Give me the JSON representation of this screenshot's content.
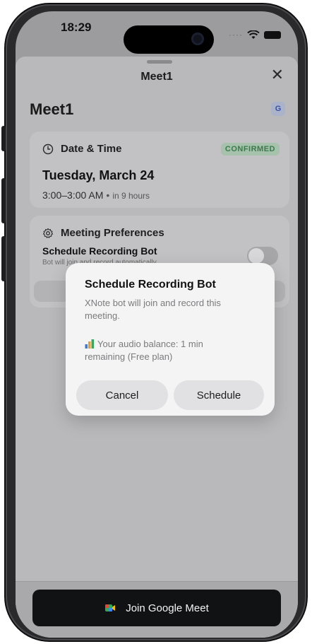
{
  "status_bar": {
    "time": "18:29",
    "signal_icon": "signal-dots-icon",
    "wifi_icon": "wifi-icon",
    "battery_icon": "battery-icon"
  },
  "sheet": {
    "title": "Meet1",
    "close_label": "✕"
  },
  "page": {
    "title": "Meet1",
    "provider_badge": "G"
  },
  "date_time_card": {
    "heading": "Date & Time",
    "status": "CONFIRMED",
    "date": "Tuesday, March 24",
    "time_range": "3:00–3:00 AM",
    "separator": "•",
    "relative": "in 9 hours"
  },
  "preferences_card": {
    "heading": "Meeting Preferences",
    "option_title": "Schedule Recording Bot",
    "option_subtitle": "Bot will join and record automatically",
    "toggle_on": false
  },
  "dialog": {
    "title": "Schedule Recording Bot",
    "message": "XNote bot will join and record this meeting.",
    "balance_text": "Your audio balance: 1 min remaining (Free plan)",
    "cancel_label": "Cancel",
    "schedule_label": "Schedule"
  },
  "footer": {
    "join_label": "Join Google Meet",
    "join_icon": "google-meet-icon"
  },
  "colors": {
    "confirmed": "#3b7a4b",
    "join_button": "#111214"
  }
}
